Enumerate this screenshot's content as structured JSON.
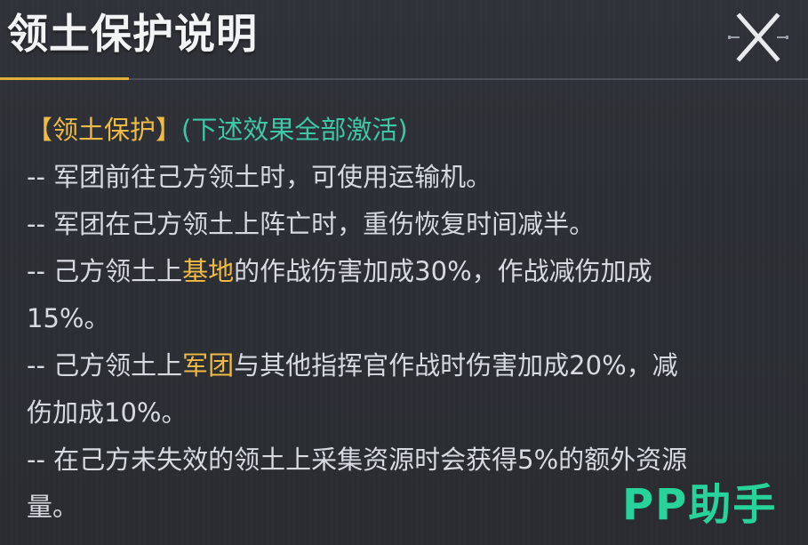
{
  "dialog": {
    "title": "领土保护说明",
    "close_icon": "close-x-icon"
  },
  "colors": {
    "accent_gold": "#f0bb45",
    "accent_teal": "#3ec7a6",
    "watermark_green": "#27d39a",
    "background": "#2d3036"
  },
  "content": {
    "heading_tag": "【领土保护】",
    "heading_note": "(下述效果全部激活)",
    "line1": "-- 军团前往己方领土时，可使用运输机。",
    "line2": "-- 军团在己方领土上阵亡时，重伤恢复时间减半。",
    "line3_pre": "-- 己方领土上",
    "line3_highlight": "基地",
    "line3_post": "的作战伤害加成30%，作战减伤加成",
    "line3_cont": "15%。",
    "line4_pre": "-- 己方领土上",
    "line4_highlight": "军团",
    "line4_post": "与其他指挥官作战时伤害加成20%，减",
    "line4_cont": "伤加成10%。",
    "line5": "-- 在己方未失效的领土上采集资源时会获得5%的额外资源",
    "line5_cont": "量。"
  },
  "watermark": {
    "text": "PP助手"
  }
}
